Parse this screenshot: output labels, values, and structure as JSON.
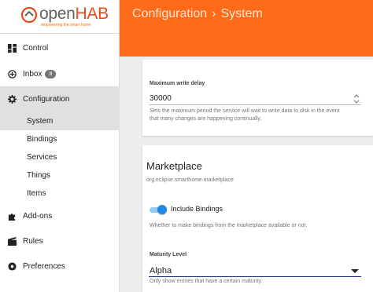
{
  "app": {
    "logo_text_o": "open",
    "logo_text_hab": "HAB",
    "logo_tagline": "empowering the smart home"
  },
  "sidebar": {
    "items": [
      {
        "label": "Control",
        "icon": "dashboard-icon"
      },
      {
        "label": "Inbox",
        "icon": "inbox-icon",
        "badge": "8"
      },
      {
        "label": "Configuration",
        "icon": "gear-icon"
      },
      {
        "label": "Add-ons",
        "icon": "puzzle-icon"
      },
      {
        "label": "Rules",
        "icon": "clapperboard-icon"
      },
      {
        "label": "Preferences",
        "icon": "settings-icon"
      }
    ],
    "subitems": [
      "System",
      "Bindings",
      "Services",
      "Things",
      "Items"
    ]
  },
  "header": {
    "section": "Configuration",
    "separator": "›",
    "page": "System"
  },
  "persistence": {
    "label": "Maximum write delay",
    "value": "30000",
    "hint_line1": "Sets the maximum period the service will wait to write data to disk in the event",
    "hint_line2": "that many changes are happening continually."
  },
  "marketplace": {
    "title": "Marketplace",
    "package": "org.eclipse.smarthome.marketplace",
    "toggle_label": "Include Bindings",
    "toggle_on": true,
    "toggle_hint": "Whether to make bindings from the marketplace available or not.",
    "maturity_label": "Maturity Level",
    "maturity_value": "Alpha",
    "maturity_hint": "Only show entries that have a certain maturity."
  },
  "colors": {
    "brand": "#ff6b19",
    "accent": "#1e88e5",
    "selected_bg": "#e0e0e0"
  }
}
